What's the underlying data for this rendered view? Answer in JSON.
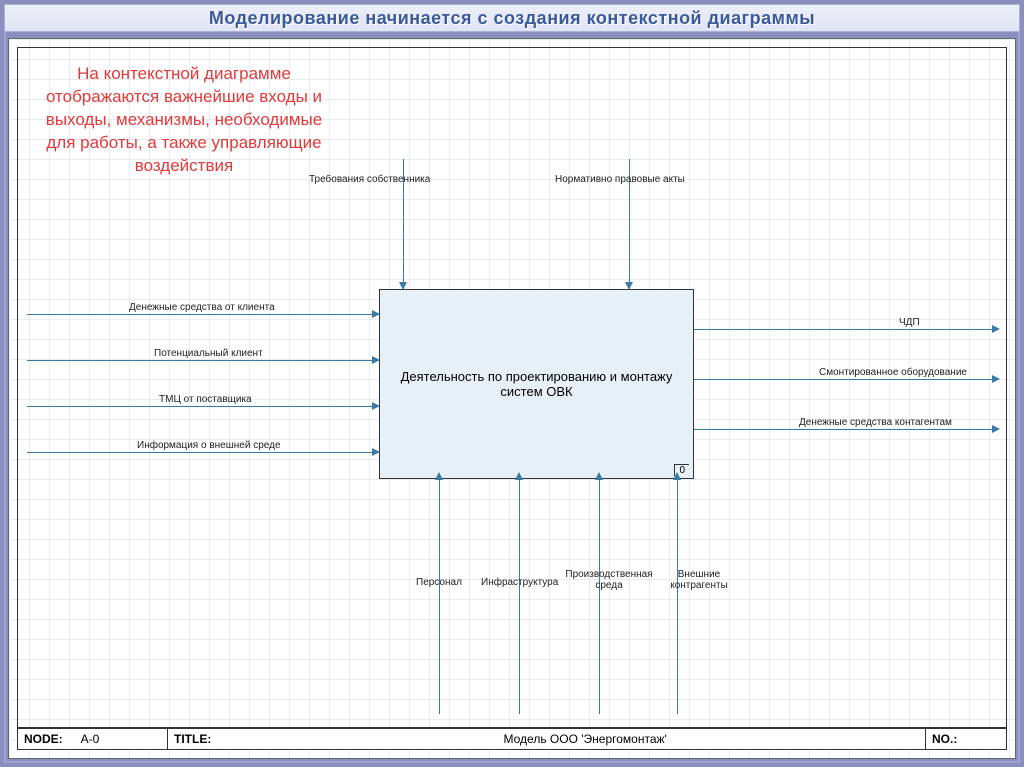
{
  "title": "Моделирование начинается с создания контекстной диаграммы",
  "annotation": "На контекстной диаграмме отображаются важнейшие входы и выходы, механизмы, необходимые для работы, а также управляющие воздействия",
  "activity": {
    "label": "Деятельность по проектированию и монтажу систем ОВК",
    "number": "0"
  },
  "controls": [
    "Требования собственника",
    "Нормативно правовые акты"
  ],
  "inputs": [
    "Денежные средства от клиента",
    "Потенциальный клиент",
    "ТМЦ от поставщика",
    "Информация о внешней среде"
  ],
  "outputs": [
    "ЧДП",
    "Смонтированное оборудование",
    "Денежные средства контагентам"
  ],
  "mechanisms": [
    "Персонал",
    "Инфраструктура",
    "Производственная среда",
    "Внешние контрагенты"
  ],
  "footer": {
    "node_label": "NODE:",
    "node_value": "A-0",
    "title_label": "TITLE:",
    "title_value": "Модель ООО 'Энергомонтаж'",
    "no_label": "NO.:"
  }
}
